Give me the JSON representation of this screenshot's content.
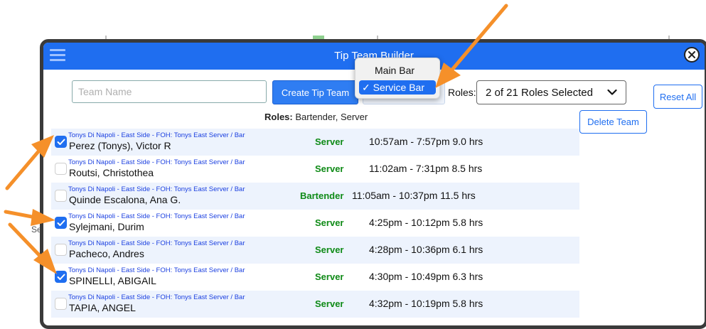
{
  "modal": {
    "title": "Tip Team Builder"
  },
  "toolbar": {
    "team_name_placeholder": "Team Name",
    "create_team_label": "Create Tip Team",
    "roles_label": "Roles:",
    "roles_selected": "2 of 21 Roles Selected",
    "reset_all_label": "Reset All",
    "delete_team_label": "Delete Team"
  },
  "bar_menu": {
    "options": [
      "Main Bar",
      "Service Bar"
    ],
    "selected": "Service Bar",
    "selected_display": "✓ Service Bar"
  },
  "roles_line": {
    "label": "Roles:",
    "value": "Bartender, Server"
  },
  "employees": [
    {
      "location": "Tonys Di Napoli - East Side - FOH: Tonys East Server / Bar",
      "name": "Perez (Tonys), Victor R",
      "role": "Server",
      "time": "10:57am -  7:57pm  9.0 hrs",
      "checked": true
    },
    {
      "location": "Tonys Di Napoli - East Side - FOH: Tonys East Server / Bar",
      "name": "Routsi, Christothea",
      "role": "Server",
      "time": "11:02am -  7:31pm  8.5 hrs",
      "checked": false
    },
    {
      "location": "Tonys Di Napoli - East Side - FOH: Tonys East Server / Bar",
      "name": "Quinde Escalona, Ana G.",
      "role": "Bartender",
      "time": "11:05am - 10:37pm  11.5 hrs",
      "checked": false
    },
    {
      "location": "Tonys Di Napoli - East Side - FOH: Tonys East Server / Bar",
      "name": "Sylejmani, Durim",
      "role": "Server",
      "time": "4:25pm - 10:12pm  5.8 hrs",
      "checked": true
    },
    {
      "location": "Tonys Di Napoli - East Side - FOH: Tonys East Server / Bar",
      "name": "Pacheco, Andres",
      "role": "Server",
      "time": "4:28pm - 10:36pm  6.1 hrs",
      "checked": false
    },
    {
      "location": "Tonys Di Napoli - East Side - FOH: Tonys East Server / Bar",
      "name": "SPINELLI, ABIGAIL",
      "role": "Server",
      "time": "4:30pm - 10:49pm  6.3 hrs",
      "checked": true
    },
    {
      "location": "Tonys Di Napoli - East Side - FOH: Tonys East Server / Bar",
      "name": "TAPIA, ANGEL",
      "role": "Server",
      "time": "4:32pm - 10:19pm  5.8 hrs",
      "checked": false
    }
  ],
  "background": {
    "ghost_text": "Se"
  },
  "colors": {
    "titlebar": "#1f6ef0",
    "accent": "#1f6ef0",
    "role_green": "#0e8a16",
    "arrow_orange": "#f5902a",
    "location_blue": "#1a3fe0"
  }
}
